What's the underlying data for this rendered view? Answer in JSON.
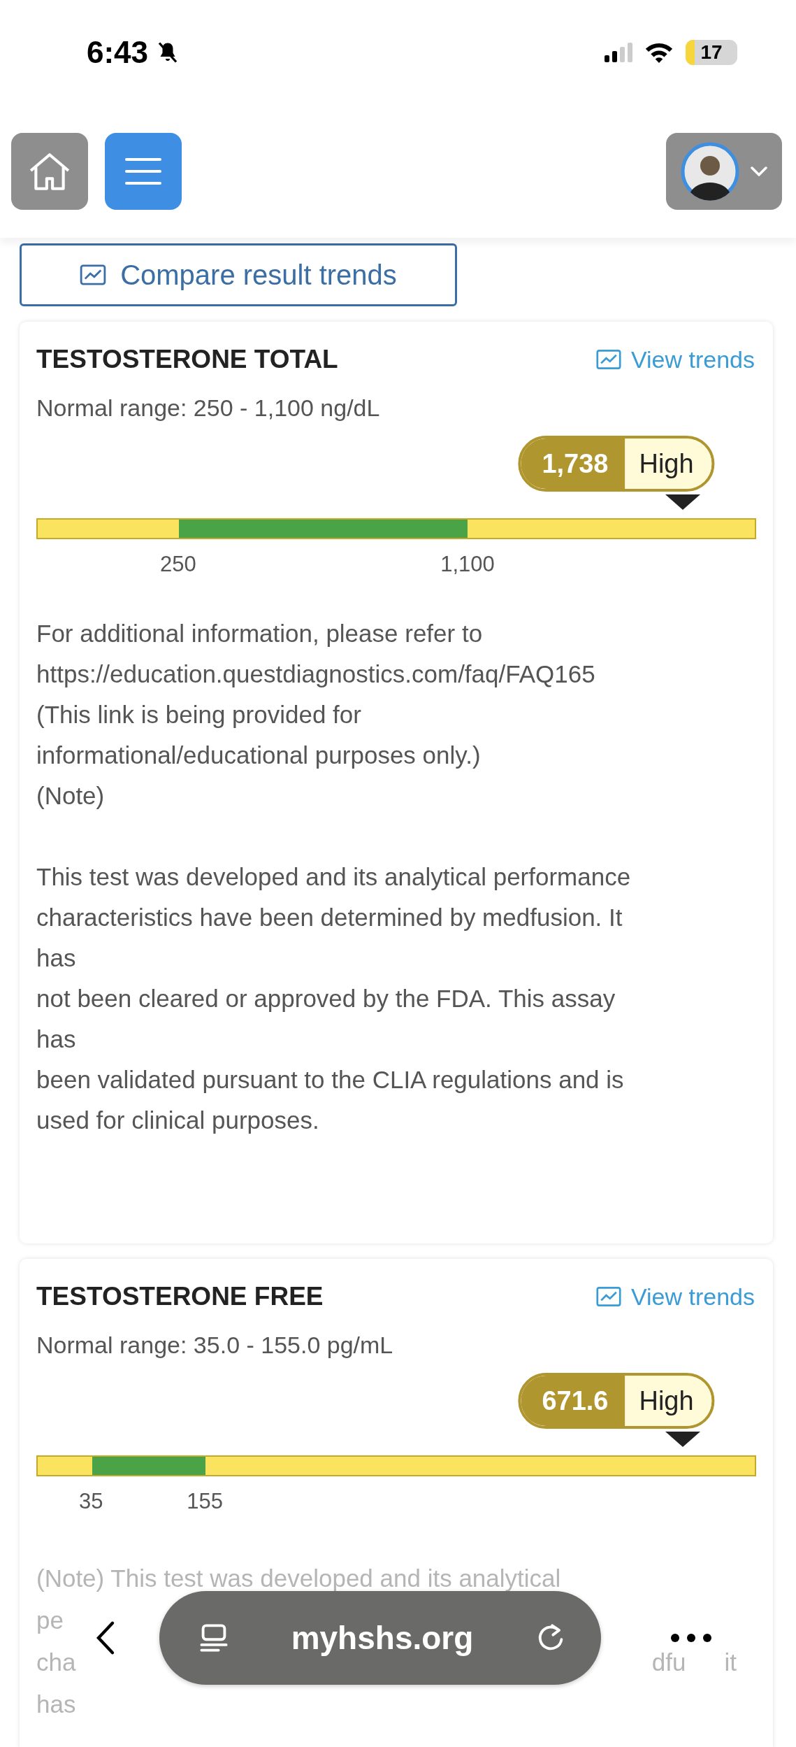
{
  "status_bar": {
    "time": "6:43",
    "battery": "17"
  },
  "compare_button": {
    "label": "Compare result trends"
  },
  "results": [
    {
      "title": "TESTOSTERONE TOTAL",
      "trends_link": "View trends",
      "normal_range": "Normal range: 250 - 1,100 ng/dL",
      "value": "1,738",
      "flag": "High",
      "marker": {
        "level": 0.9
      },
      "segments": [
        {
          "kind": "abnormal",
          "level": 0.197
        },
        {
          "kind": "normal",
          "level": 0.402
        },
        {
          "kind": "abnormal",
          "level": 0.401
        }
      ],
      "ticks": [
        "250",
        "1,100"
      ],
      "notes": [
        [
          "For additional information, please refer to",
          "https://education.questdiagnostics.com/faq/FAQ165",
          "(This link is being provided for",
          "informational/educational purposes only.)",
          "(Note)"
        ],
        [
          "This test was developed and its analytical performance",
          "characteristics have been determined by medfusion. It",
          "has",
          "not been cleared or approved by the FDA. This assay",
          "has",
          "been validated pursuant to the CLIA regulations and is",
          "used for clinical purposes."
        ]
      ]
    },
    {
      "title": "TESTOSTERONE FREE",
      "trends_link": "View trends",
      "normal_range": "Normal range: 35.0 - 155.0 pg/mL",
      "value": "671.6",
      "flag": "High",
      "marker": {
        "level": 0.9
      },
      "segments": [
        {
          "kind": "abnormal",
          "level": 0.076
        },
        {
          "kind": "normal",
          "level": 0.158
        },
        {
          "kind": "abnormal",
          "level": 0.766
        }
      ],
      "ticks": [
        "35",
        "155"
      ],
      "faded_lines": [
        [
          "(Note) This test was developed and its analytical"
        ],
        [
          "pe"
        ],
        [
          "cha",
          "dfu",
          "it"
        ],
        [
          "has"
        ]
      ]
    }
  ],
  "browser_bar": {
    "url": "myhshs.org"
  }
}
